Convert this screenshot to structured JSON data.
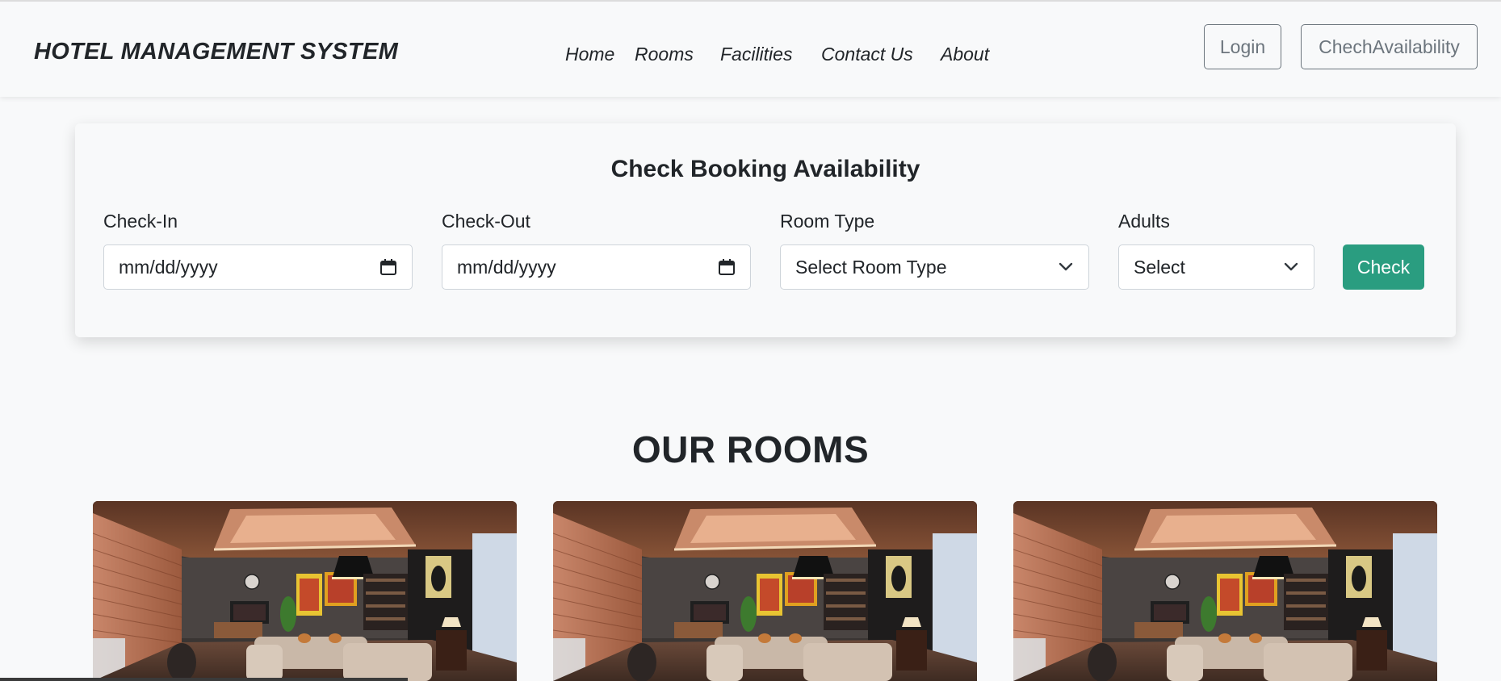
{
  "navbar": {
    "brand": "HOTEL MANAGEMENT SYSTEM",
    "links": [
      "Home",
      "Rooms",
      "Facilities",
      "Contact Us",
      "About"
    ],
    "login_label": "Login",
    "availability_label": "ChechAvailability"
  },
  "booking": {
    "title": "Check Booking Availability",
    "checkin": {
      "label": "Check-In",
      "placeholder": "mm/dd/yyyy"
    },
    "checkout": {
      "label": "Check-Out",
      "placeholder": "mm/dd/yyyy"
    },
    "room_type": {
      "label": "Room Type",
      "selected": "Select Room Type"
    },
    "adults": {
      "label": "Adults",
      "selected": "Select"
    },
    "check_label": "Check",
    "accent_color": "#2a9d80"
  },
  "rooms": {
    "title": "OUR ROOMS",
    "cards": [
      {
        "image": "living-room-photo"
      },
      {
        "image": "living-room-photo"
      },
      {
        "image": "living-room-photo"
      }
    ]
  }
}
